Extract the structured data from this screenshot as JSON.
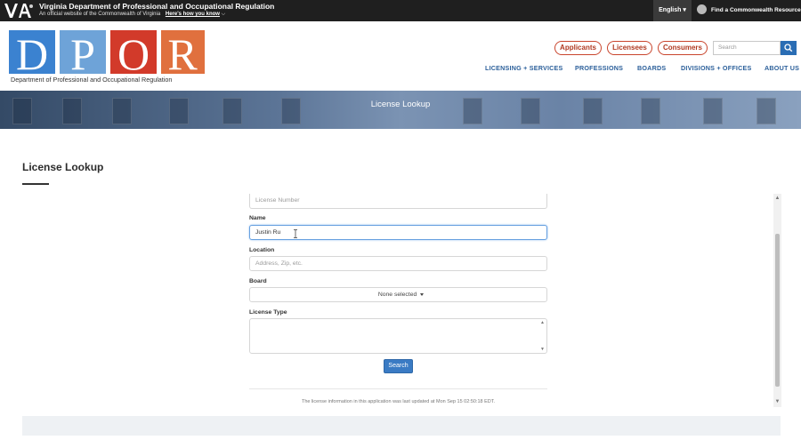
{
  "topbar": {
    "logo_text": "VA",
    "title": "Virginia Department of Professional and Occupational Regulation",
    "subtitle": "An official website of the Commonwealth of Virginia",
    "how_link": "Here's how you know",
    "language": "English",
    "resource_link": "Find a Commonwealth Resource"
  },
  "header": {
    "logo_letters": [
      "D",
      "P",
      "O",
      "R"
    ],
    "logo_caption": "Department of Professional and Occupational Regulation",
    "pills": [
      "Applicants",
      "Licensees",
      "Consumers"
    ],
    "search_placeholder": "Search",
    "nav": [
      "LICENSING + SERVICES",
      "PROFESSIONS",
      "BOARDS",
      "DIVISIONS + OFFICES",
      "ABOUT US"
    ]
  },
  "banner": {
    "title": "License Lookup"
  },
  "page": {
    "title": "License Lookup"
  },
  "form": {
    "license_number_placeholder": "License Number",
    "name_label": "Name",
    "name_value": "Justin Ru",
    "location_label": "Location",
    "location_placeholder": "Address, Zip, etc.",
    "board_label": "Board",
    "board_value": "None selected",
    "license_type_label": "License Type",
    "search_button": "Search",
    "footnote": "The license information in this application was last updated at Mon Sep 15 02:50:18 EDT."
  },
  "colors": {
    "logo_blue": "#3b82d0",
    "logo_red": "#d23a2a",
    "logo_orange": "#e0703e",
    "nav_blue": "#2b5f9a",
    "pill_red": "#c9452d",
    "button_blue": "#3a7bc4"
  }
}
